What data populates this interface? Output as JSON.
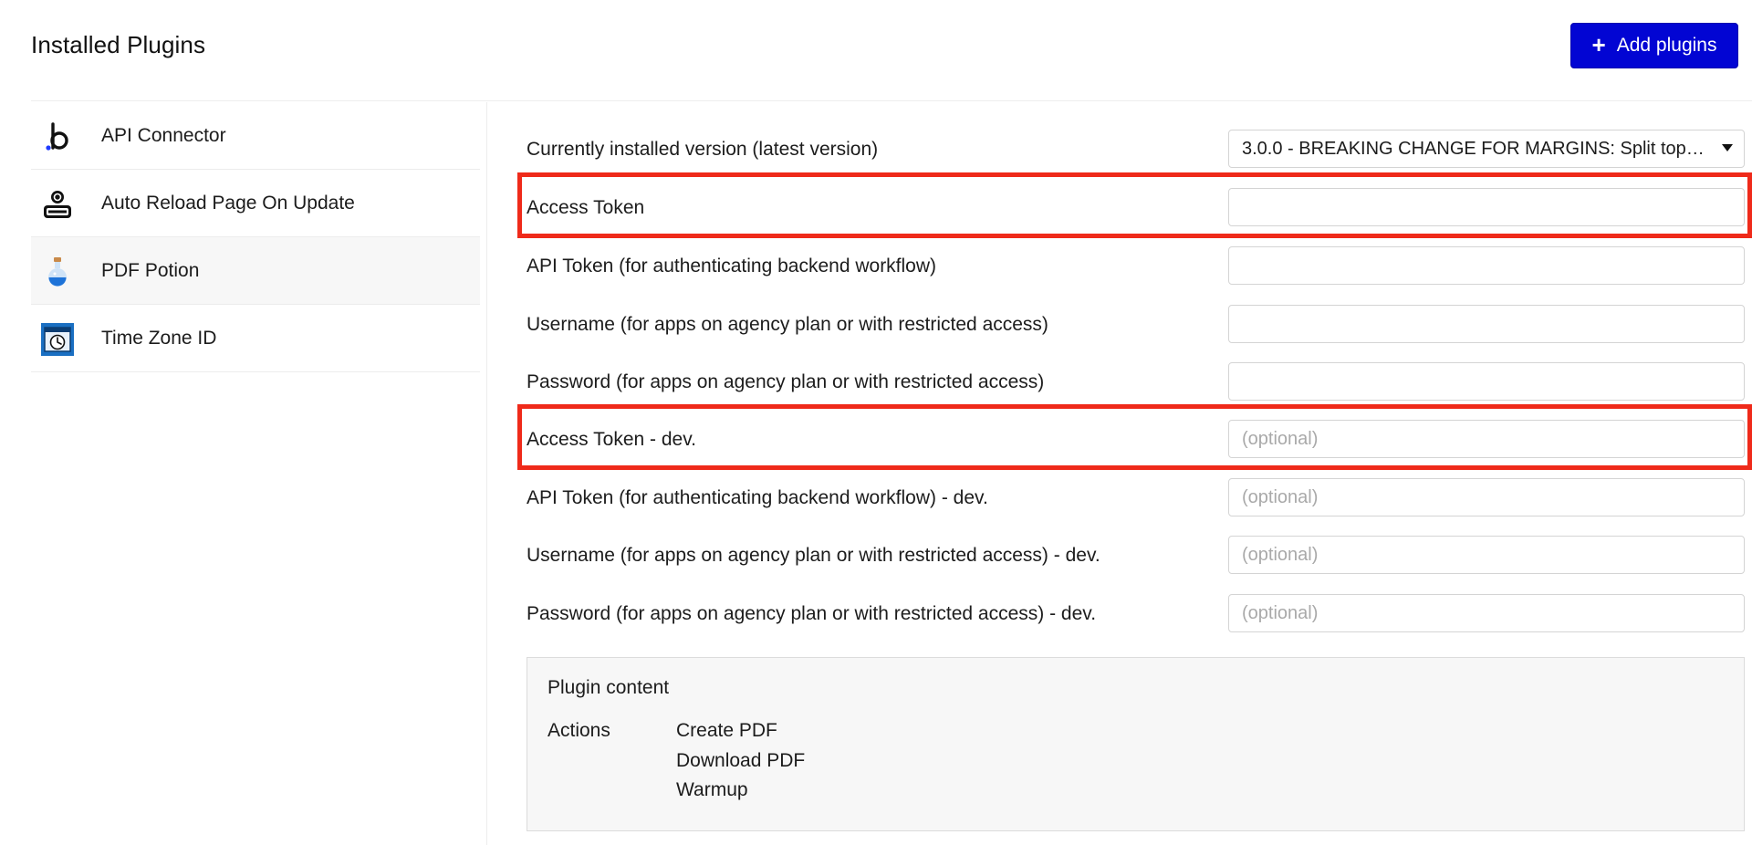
{
  "header": {
    "title": "Installed Plugins",
    "add_button_label": "Add plugins"
  },
  "sidebar": {
    "items": [
      {
        "label": "API Connector",
        "icon": "bubble-b-logo-icon"
      },
      {
        "label": "Auto Reload Page On Update",
        "icon": "refresh-logo-icon"
      },
      {
        "label": "PDF Potion",
        "icon": "potion-bottle-icon",
        "selected": true
      },
      {
        "label": "Time Zone ID",
        "icon": "clock-window-icon"
      }
    ]
  },
  "settings": {
    "version_label": "Currently installed version (latest version)",
    "version_value": "3.0.0 - BREAKING CHANGE FOR MARGINS: Split top/bottom margins",
    "fields": [
      {
        "label": "Access Token",
        "value": "",
        "placeholder": ""
      },
      {
        "label": "API Token (for authenticating backend workflow)",
        "value": "",
        "placeholder": ""
      },
      {
        "label": "Username (for apps on agency plan or with restricted access)",
        "value": "",
        "placeholder": ""
      },
      {
        "label": "Password (for apps on agency plan or with restricted access)",
        "value": "",
        "placeholder": ""
      },
      {
        "label": "Access Token - dev.",
        "value": "",
        "placeholder": "(optional)"
      },
      {
        "label": "API Token (for authenticating backend workflow) - dev.",
        "value": "",
        "placeholder": "(optional)"
      },
      {
        "label": "Username (for apps on agency plan or with restricted access) - dev.",
        "value": "",
        "placeholder": "(optional)"
      },
      {
        "label": "Password (for apps on agency plan or with restricted access) - dev.",
        "value": "",
        "placeholder": "(optional)"
      }
    ]
  },
  "plugin_content": {
    "title": "Plugin content",
    "actions_label": "Actions",
    "actions": [
      "Create PDF",
      "Download PDF",
      "Warmup"
    ]
  },
  "colors": {
    "primary_button": "#0205d3",
    "highlight_box": "#ef2a1a"
  }
}
